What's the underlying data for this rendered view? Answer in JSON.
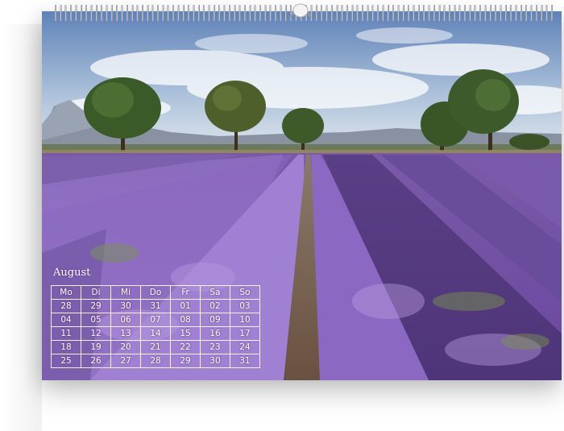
{
  "calendar": {
    "month": "August",
    "weekdays": [
      "Mo",
      "Di",
      "Mi",
      "Do",
      "Fr",
      "Sa",
      "So"
    ],
    "weeks": [
      [
        "28",
        "29",
        "30",
        "31",
        "01",
        "02",
        "03"
      ],
      [
        "04",
        "05",
        "06",
        "07",
        "08",
        "09",
        "10"
      ],
      [
        "11",
        "12",
        "13",
        "14",
        "15",
        "16",
        "17"
      ],
      [
        "18",
        "19",
        "20",
        "21",
        "22",
        "23",
        "24"
      ],
      [
        "25",
        "26",
        "27",
        "28",
        "29",
        "30",
        "31"
      ]
    ]
  },
  "photo": {
    "subject": "lavender-field-with-trees",
    "colors": {
      "sky_top": "#6f8fc0",
      "sky_bottom": "#dbe5ef",
      "lavender_dark": "#5d3e8c",
      "lavender_light": "#9a76c8",
      "tree": "#3d5a2a",
      "path": "#8a7260"
    }
  }
}
